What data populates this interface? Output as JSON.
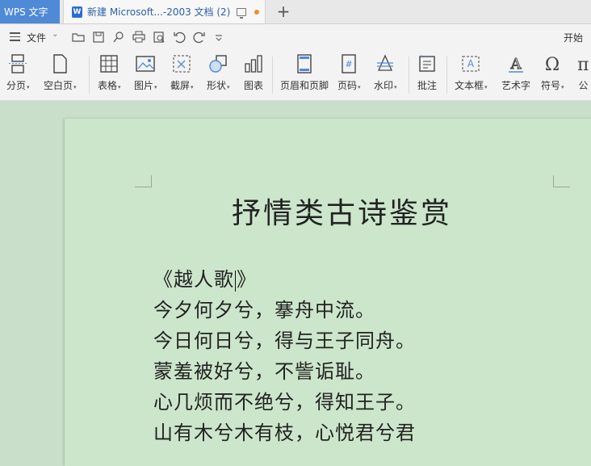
{
  "titlebar": {
    "app_tab": "WPS 文字",
    "doc_tab": "新建 Microsoft...-2003 文档 (2)",
    "new_tab": "+"
  },
  "menubar": {
    "file": "文件",
    "start": "开始"
  },
  "ribbon": {
    "items": [
      {
        "label": "分页",
        "icon": "page-break-icon",
        "dropdown": true
      },
      {
        "label": "空白页",
        "icon": "blank-page-icon",
        "dropdown": true
      },
      {
        "label": "表格",
        "icon": "table-icon",
        "dropdown": true
      },
      {
        "label": "图片",
        "icon": "picture-icon",
        "dropdown": true
      },
      {
        "label": "截屏",
        "icon": "screenshot-icon",
        "dropdown": true
      },
      {
        "label": "形状",
        "icon": "shape-icon",
        "dropdown": true
      },
      {
        "label": "图表",
        "icon": "chart-icon",
        "dropdown": false
      },
      {
        "label": "页眉和页脚",
        "icon": "header-footer-icon",
        "dropdown": false
      },
      {
        "label": "页码",
        "icon": "page-number-icon",
        "dropdown": true
      },
      {
        "label": "水印",
        "icon": "watermark-icon",
        "dropdown": true
      },
      {
        "label": "批注",
        "icon": "comment-icon",
        "dropdown": false
      },
      {
        "label": "文本框",
        "icon": "textbox-icon",
        "dropdown": true
      },
      {
        "label": "艺术字",
        "icon": "wordart-icon",
        "dropdown": false
      },
      {
        "label": "符号",
        "icon": "symbol-icon",
        "dropdown": true
      },
      {
        "label": "公",
        "icon": "formula-icon",
        "dropdown": false
      }
    ]
  },
  "document": {
    "title": "抒情类古诗鉴赏",
    "poem_title_before_cursor": "《越人歌",
    "poem_title_after_cursor": "》",
    "lines": [
      "今夕何夕兮，搴舟中流。",
      "今日何日兮，得与王子同舟。",
      "蒙羞被好兮，不訾诟耻。",
      "心几烦而不绝兮，得知王子。",
      "山有木兮木有枝，心悦君兮君"
    ],
    "colors": {
      "page": "#cce6cc",
      "background": "#c9dfc9",
      "accent": "#4f8ad6"
    }
  }
}
